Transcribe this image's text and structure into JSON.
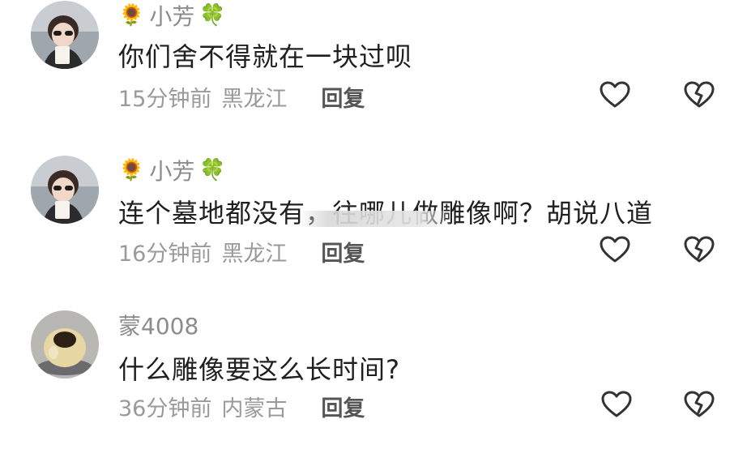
{
  "comments": [
    {
      "username": "小芳",
      "name_prefix_emoji": "🌻",
      "name_suffix_emoji": "🍀",
      "text": "你们舍不得就在一块过呗",
      "time": "15分钟前",
      "location": "黑龙江",
      "reply_label": "回复",
      "avatar": "woman-with-glasses-avatar",
      "like_icon": "heart-outline-icon",
      "dislike_icon": "broken-heart-icon"
    },
    {
      "username": "小芳",
      "name_prefix_emoji": "🌻",
      "name_suffix_emoji": "🍀",
      "text": "连个墓地都没有，往哪儿做雕像啊？胡说八道",
      "time": "16分钟前",
      "location": "黑龙江",
      "reply_label": "回复",
      "avatar": "woman-with-glasses-avatar",
      "like_icon": "heart-outline-icon",
      "dislike_icon": "broken-heart-icon"
    },
    {
      "username": "蒙4008",
      "name_prefix_emoji": "",
      "name_suffix_emoji": "",
      "text": "什么雕像要这么长时间?",
      "time": "36分钟前",
      "location": "内蒙古",
      "reply_label": "回复",
      "avatar": "steamed-bun-avatar",
      "like_icon": "heart-outline-icon",
      "dislike_icon": "broken-heart-icon"
    }
  ],
  "colors": {
    "username": "#8c8c8c",
    "text": "#1f1f1f",
    "meta": "#9a9a9a",
    "reply": "#555555",
    "icon_stroke": "#333333"
  }
}
